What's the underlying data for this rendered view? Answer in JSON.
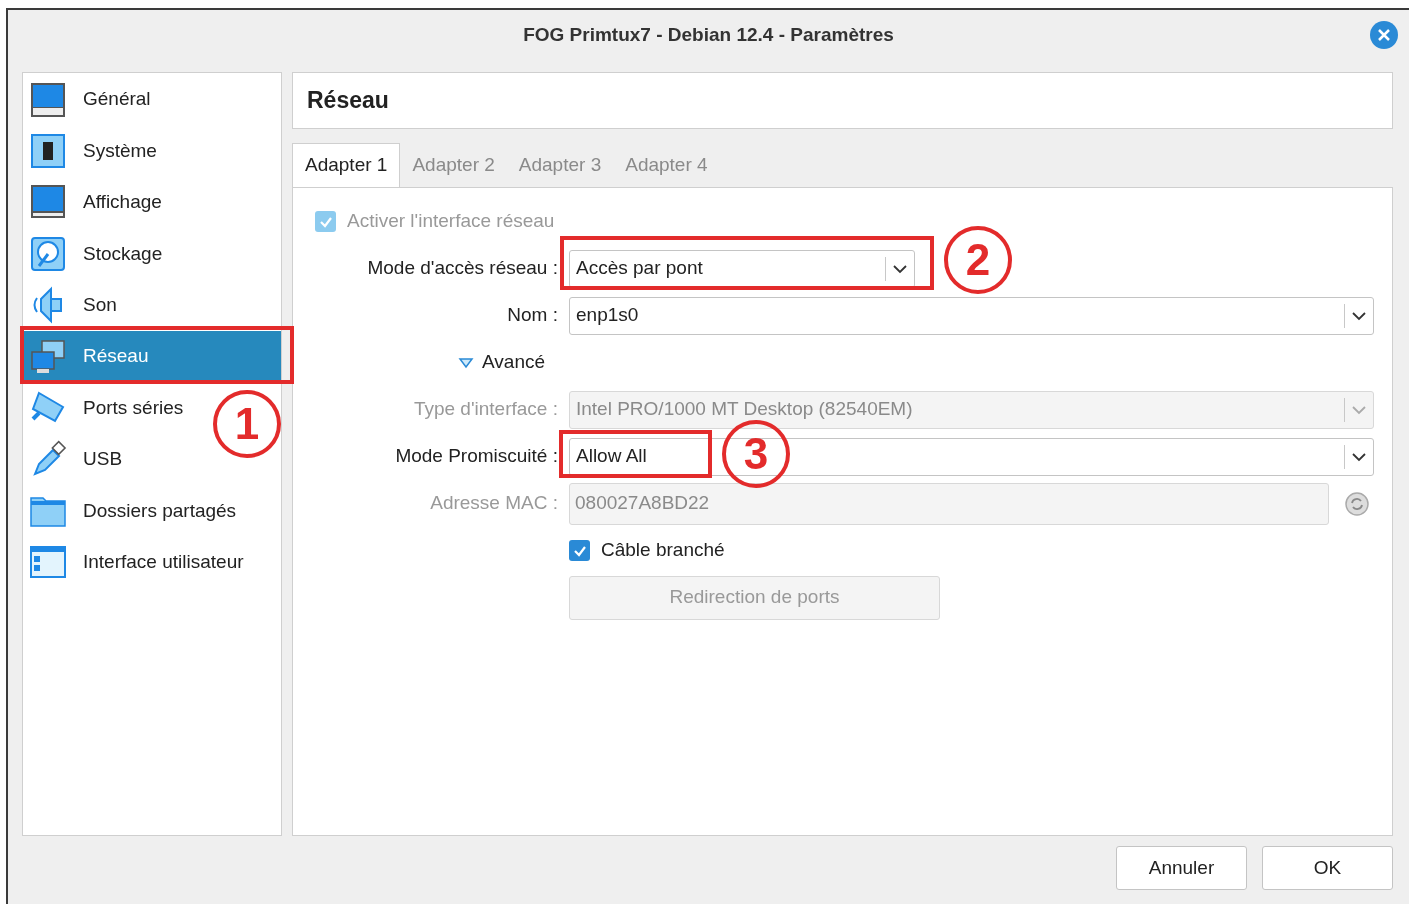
{
  "window": {
    "title": "FOG Primtux7 - Debian 12.4 - Paramètres"
  },
  "sidebar": {
    "items": [
      {
        "label": "Général",
        "selected": false
      },
      {
        "label": "Système",
        "selected": false
      },
      {
        "label": "Affichage",
        "selected": false
      },
      {
        "label": "Stockage",
        "selected": false
      },
      {
        "label": "Son",
        "selected": false
      },
      {
        "label": "Réseau",
        "selected": true
      },
      {
        "label": "Ports séries",
        "selected": false
      },
      {
        "label": "USB",
        "selected": false
      },
      {
        "label": "Dossiers partagés",
        "selected": false
      },
      {
        "label": "Interface utilisateur",
        "selected": false
      }
    ]
  },
  "section_title": "Réseau",
  "tabs": [
    {
      "label": "Adapter 1",
      "selected": true
    },
    {
      "label": "Adapter 2",
      "selected": false
    },
    {
      "label": "Adapter 3",
      "selected": false
    },
    {
      "label": "Adapter 4",
      "selected": false
    }
  ],
  "form": {
    "rows": [
      {
        "kind": "checkbox",
        "label": "Activer l'interface réseau",
        "checked": true,
        "disabled": true
      },
      {
        "kind": "combo",
        "label": "Mode d'accès réseau :",
        "value": "Accès par pont",
        "disabled": false
      },
      {
        "kind": "combo",
        "label": "Nom :",
        "value": "enp1s0",
        "disabled": false
      },
      {
        "kind": "disclosure",
        "label": "Avancé",
        "expanded": true
      },
      {
        "kind": "combo",
        "label": "Type d'interface :",
        "value": "Intel PRO/1000 MT Desktop (82540EM)",
        "disabled": true
      },
      {
        "kind": "combo",
        "label": "Mode Promiscuité :",
        "value": "Allow All",
        "disabled": false
      },
      {
        "kind": "text",
        "label": "Adresse MAC :",
        "value": "080027A8BD22",
        "disabled": true
      },
      {
        "kind": "checkbox",
        "label": "Câble branché",
        "checked": true,
        "disabled": false
      },
      {
        "kind": "button",
        "label": "Redirection de ports",
        "disabled": true
      }
    ]
  },
  "annotations": [
    {
      "number": "1"
    },
    {
      "number": "2"
    },
    {
      "number": "3"
    }
  ],
  "buttons": [
    "Annuler",
    "OK"
  ]
}
